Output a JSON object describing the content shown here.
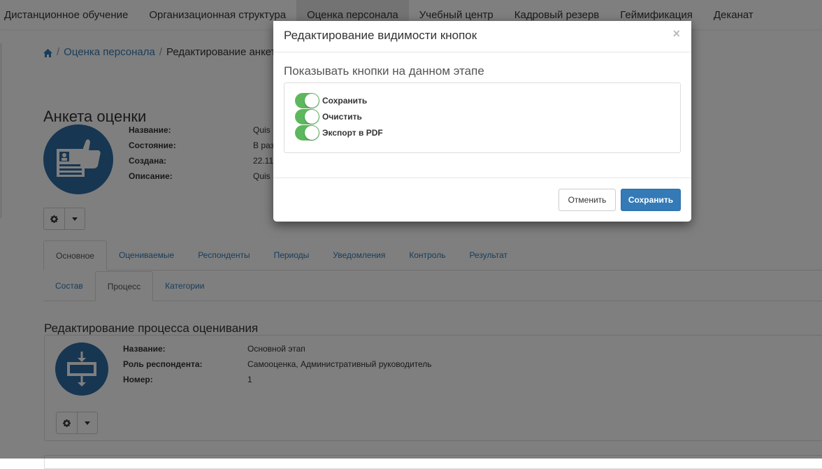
{
  "topnav": {
    "items": [
      {
        "label": "Дистанционное обучение"
      },
      {
        "label": "Организационная структура"
      },
      {
        "label": "Оценка персонала"
      },
      {
        "label": "Учебный центр"
      },
      {
        "label": "Кадровый резерв"
      },
      {
        "label": "Геймификация"
      },
      {
        "label": "Деканат"
      }
    ],
    "active_index": 2
  },
  "breadcrumb": {
    "link": "Оценка персонала",
    "current": "Редактирование анкеты"
  },
  "page_title": "Анкета оценки",
  "survey": {
    "fields": [
      {
        "key": "Название:",
        "value": "Quis"
      },
      {
        "key": "Состояние:",
        "value": "В раз"
      },
      {
        "key": "Создана:",
        "value": "22.11"
      },
      {
        "key": "Описание:",
        "value": "Quis"
      }
    ]
  },
  "tabs_main": [
    {
      "label": "Основное",
      "active": true
    },
    {
      "label": "Оцениваемые"
    },
    {
      "label": "Респонденты"
    },
    {
      "label": "Периоды"
    },
    {
      "label": "Уведомления"
    },
    {
      "label": "Контроль"
    },
    {
      "label": "Результат"
    }
  ],
  "tabs_sub": [
    {
      "label": "Состав"
    },
    {
      "label": "Процесс",
      "active": true
    },
    {
      "label": "Категории"
    }
  ],
  "process": {
    "section_title": "Редактирование процесса оценивания",
    "fields": [
      {
        "key": "Название:",
        "value": "Основной этап"
      },
      {
        "key": "Роль респондента:",
        "value": "Самооценка, Административный руководитель"
      },
      {
        "key": "Номер:",
        "value": "1"
      }
    ]
  },
  "modal": {
    "title": "Редактирование видимости кнопок",
    "close_glyph": "×",
    "subtitle": "Показывать кнопки на данном этапе",
    "switches": [
      {
        "label": "Сохранить",
        "on": true
      },
      {
        "label": "Очистить",
        "on": true
      },
      {
        "label": "Экспорт в PDF",
        "on": true
      }
    ],
    "cancel_label": "Отменить",
    "save_label": "Сохранить"
  },
  "colors": {
    "primary": "#337ab7",
    "switch_on": "#5cb85c",
    "icon_circle": "#2e6da4"
  },
  "icons": {
    "home": "home-icon",
    "gear": "gear-icon",
    "caret": "caret-down-icon",
    "survey": "survey-thumbs-up-icon",
    "process": "process-flow-icon"
  }
}
